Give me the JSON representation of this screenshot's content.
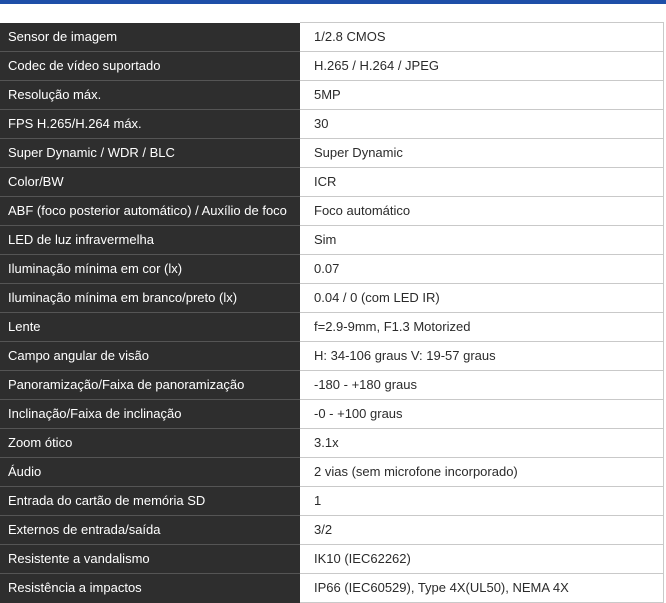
{
  "accent_color": "#1e4fa8",
  "specs": [
    {
      "label": "Sensor de imagem",
      "value": "1/2.8 CMOS"
    },
    {
      "label": "Codec de vídeo suportado",
      "value": "H.265 / H.264 / JPEG"
    },
    {
      "label": "Resolução máx.",
      "value": "5MP"
    },
    {
      "label": "FPS H.265/H.264 máx.",
      "value": "30"
    },
    {
      "label": "Super Dynamic / WDR / BLC",
      "value": "Super Dynamic"
    },
    {
      "label": "Color/BW",
      "value": "ICR"
    },
    {
      "label": "ABF (foco posterior automático) / Auxílio de foco",
      "value": "Foco automático"
    },
    {
      "label": "LED de luz infravermelha",
      "value": "Sim"
    },
    {
      "label": "Iluminação mínima em cor (lx)",
      "value": "0.07"
    },
    {
      "label": "Iluminação mínima em branco/preto (lx)",
      "value": "0.04 / 0 (com LED IR)"
    },
    {
      "label": "Lente",
      "value": "f=2.9-9mm, F1.3 Motorized"
    },
    {
      "label": "Campo angular de visão",
      "value": "H: 34-106 graus V: 19-57 graus"
    },
    {
      "label": "Panoramização/Faixa de panoramização",
      "value": "-180 - +180 graus"
    },
    {
      "label": "Inclinação/Faixa de inclinação",
      "value": "-0 - +100 graus"
    },
    {
      "label": "Zoom ótico",
      "value": "3.1x"
    },
    {
      "label": "Áudio",
      "value": "2 vias (sem microfone incorporado)"
    },
    {
      "label": "Entrada do cartão de memória SD",
      "value": "1"
    },
    {
      "label": "Externos de entrada/saída",
      "value": "3/2"
    },
    {
      "label": "Resistente a vandalismo",
      "value": "IK10 (IEC62262)"
    },
    {
      "label": "Resistência a impactos",
      "value": "IP66 (IEC60529), Type 4X(UL50), NEMA 4X"
    }
  ]
}
